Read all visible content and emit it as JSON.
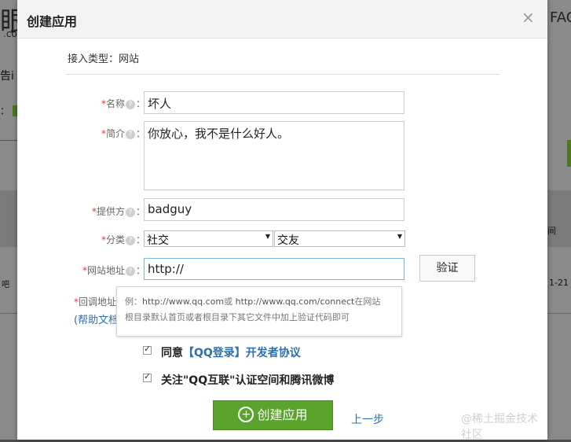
{
  "background": {
    "title_fragment": "眼",
    "sub_fragment": ".co",
    "text1": "告i",
    "text2": "：",
    "right_fragment": "FAC",
    "right_col": "间",
    "right_date": "1-21",
    "left_dot": "吧"
  },
  "dialog": {
    "title": "创建应用",
    "close_glyph": "×",
    "access_type": "接入类型：网站"
  },
  "form": {
    "name_label": "名称",
    "name_value": "坏人",
    "intro_label": "简介",
    "intro_value": "你放心，我不是什么好人。",
    "provider_label": "提供方",
    "provider_value": "badguy",
    "category_label": "分类",
    "category_primary": "社交",
    "category_secondary": "交友",
    "site_label": "网站地址",
    "site_value": "http://",
    "verify_label": "验证",
    "callback_label": "回调地址",
    "help_doc": "(帮助文档",
    "colon": "："
  },
  "tooltip": {
    "prefix": "例：",
    "url1": "http://www.qq.com",
    "or": "或 ",
    "url2": "http://www.qq.com/connect",
    "line1_tail": "在网站",
    "line2": "根目录默认首页或者根目录下其它文件中加上验证代码即可"
  },
  "agreements": {
    "agree_prefix": "同意",
    "agree_link": "【QQ登录】开发者协议",
    "follow": "关注\"QQ互联\"认证空间和腾讯微博"
  },
  "actions": {
    "create": "创建应用",
    "prev": "上一步"
  },
  "watermark": "@稀土掘金技术社区",
  "colors": {
    "accent_green": "#5aa32c",
    "link_blue": "#2a6fb0",
    "required_red": "#e4393c"
  }
}
